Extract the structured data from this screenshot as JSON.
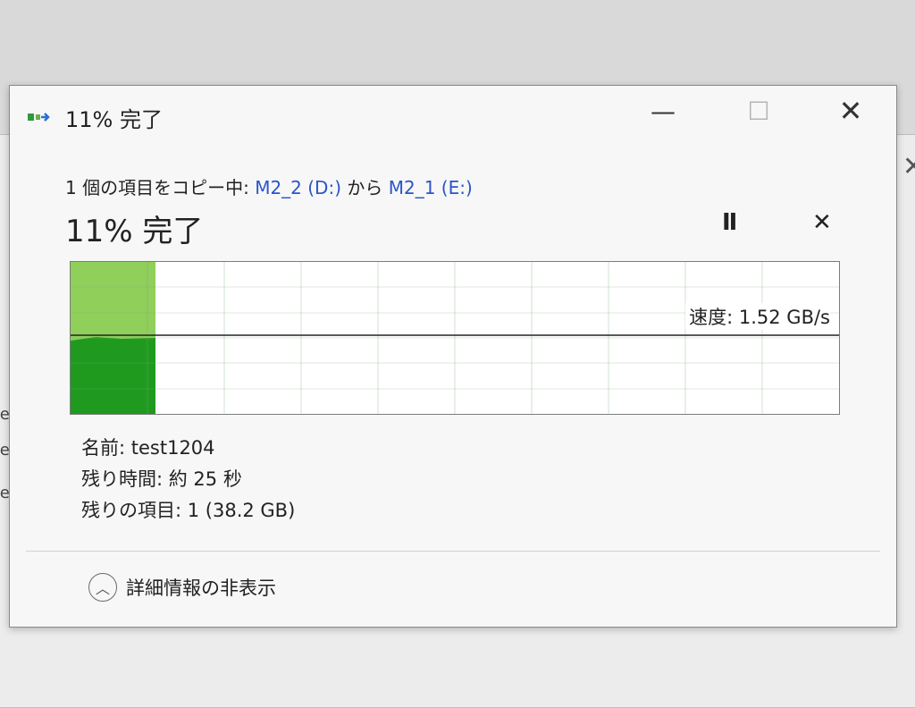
{
  "background": {
    "rows": [
      "rue",
      "rue",
      "rue"
    ],
    "accent": "#2a6fd6"
  },
  "dialog": {
    "title": "11% 完了",
    "window_buttons": {
      "minimize": "—",
      "maximize": "☐",
      "close": "✕"
    },
    "copy_line": {
      "prefix": "1 個の項目をコピー中: ",
      "source": "M2_2 (D:)",
      "middle": " から ",
      "destination": "M2_1 (E:)"
    },
    "status": "11% 完了",
    "controls": {
      "pause": "II",
      "cancel": "✕"
    },
    "progress": {
      "percent": 11
    },
    "speed": "速度: 1.52 GB/s",
    "details": {
      "name": "名前: test1204",
      "time_remaining": "残り時間: 約 25 秒",
      "items_remaining": "残りの項目: 1 (38.2 GB)"
    },
    "toggle_details": "詳細情報の非表示"
  },
  "colors": {
    "progress_fill": "#8fcf5a",
    "speed_fill": "#1f9a1f",
    "speed_line": "#222222",
    "link": "#2a55c9"
  }
}
